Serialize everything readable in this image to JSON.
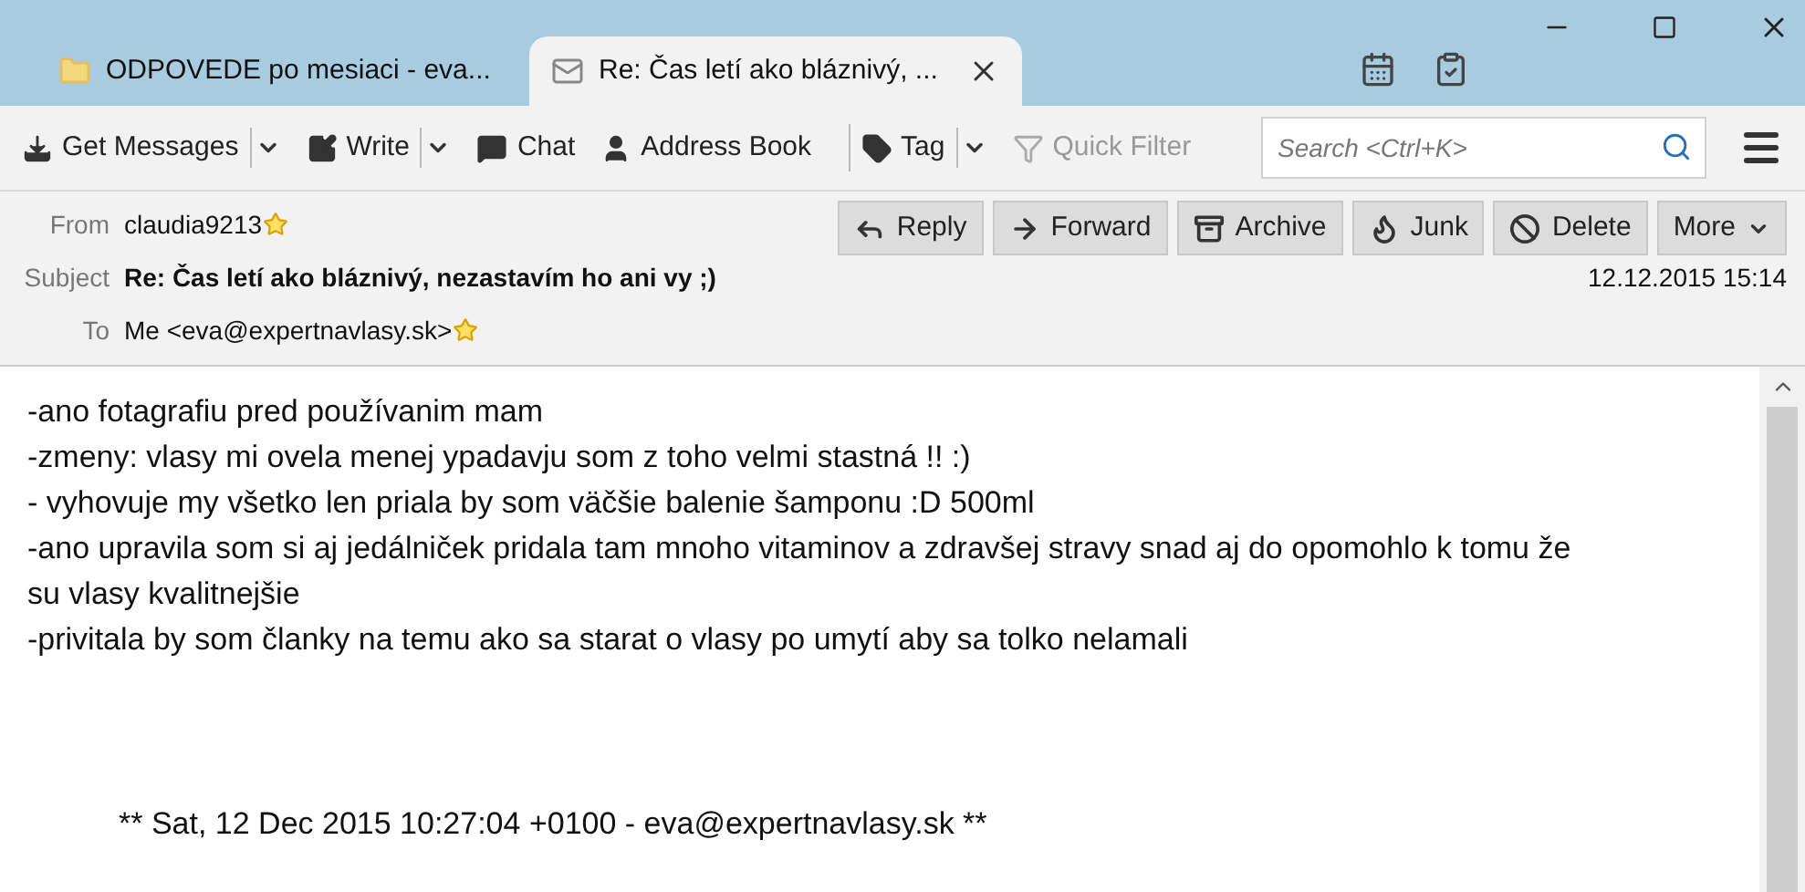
{
  "tabs": [
    {
      "label": "ODPOVEDE po mesiaci - eva...",
      "selected": false
    },
    {
      "label": "Re: Čas letí ako bláznivý, ...",
      "selected": true
    }
  ],
  "toolbar": {
    "buttons": [
      {
        "label": "Get Messages",
        "has_menu": true,
        "disabled": false
      },
      {
        "label": "Write",
        "has_menu": true,
        "disabled": false
      },
      {
        "label": "Chat",
        "has_menu": false,
        "disabled": false
      },
      {
        "label": "Address Book",
        "has_menu": false,
        "disabled": false
      },
      {
        "label": "Tag",
        "has_menu": true,
        "disabled": false
      },
      {
        "label": "Quick Filter",
        "has_menu": false,
        "disabled": true
      }
    ],
    "search": {
      "placeholder": "Search <Ctrl+K>"
    }
  },
  "header": {
    "from_label": "From",
    "from": "claudia9213",
    "subject_label": "Subject",
    "subject": "Re: Čas letí ako bláznivý, nezastavím ho ani vy ;)",
    "to_label": "To",
    "to": "Me <eva@expertnavlasy.sk>",
    "date": "12.12.2015 15:14",
    "actions": [
      {
        "label": "Reply",
        "has_menu": false
      },
      {
        "label": "Forward",
        "has_menu": false
      },
      {
        "label": "Archive",
        "has_menu": false
      },
      {
        "label": "Junk",
        "has_menu": false
      },
      {
        "label": "Delete",
        "has_menu": false
      },
      {
        "label": "More",
        "has_menu": true
      }
    ]
  },
  "body": {
    "lines": [
      "-ano fotagrafiu pred používanim mam",
      "-zmeny: vlasy mi ovela menej ypadavju som z toho velmi stastná !! :)",
      "- vyhovuje my všetko len priala by som väčšie balenie šamponu :D 500ml",
      "-ano upravila som si aj jedálniček pridala tam mnoho vitaminov a zdravšej stravy snad aj do opomohlo k tomu že su vlasy kvalitnejšie",
      "-privitala by som članky na temu ako sa starat o vlasy po umytí aby sa tolko nelamali"
    ],
    "signature": "** Sat, 12 Dec 2015 10:27:04 +0100 - eva@expertnavlasy.sk **"
  }
}
